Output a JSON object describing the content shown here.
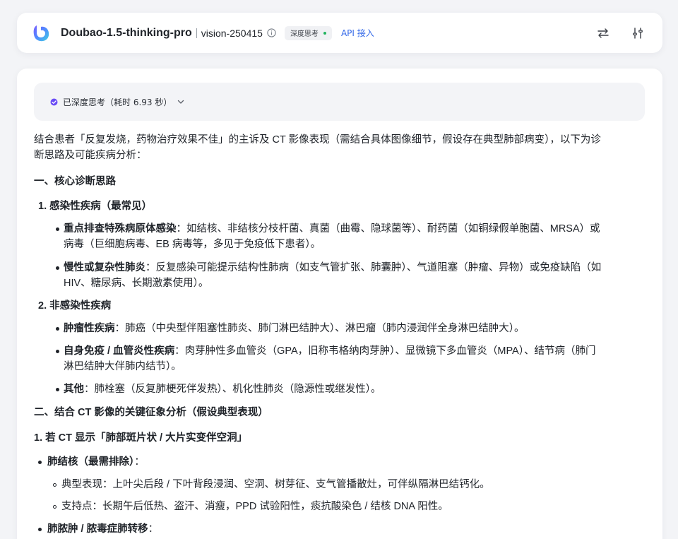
{
  "header": {
    "model_name": "Doubao-1.5-thinking-pro",
    "model_version": "vision-250415",
    "badge_label": "深度思考",
    "api_link": "API 接入"
  },
  "thinking": {
    "label": "已深度思考（耗时 6.93 秒）"
  },
  "content": {
    "intro_line1": "结合患者「反复发烧，药物治疗效果不佳」的主诉及 CT 影像表现（需结合具体图像细节，假设存在典型肺部病变），以下为诊",
    "intro_line2": "断思路及可能疾病分析：",
    "section1_title": "一、核心诊断思路",
    "s1_item1_title": "1. 感染性疾病（最常见）",
    "s1_i1_b1_bold": "重点排查特殊病原体感染",
    "s1_i1_b1_line1": "：如结核、非结核分枝杆菌、真菌（曲霉、隐球菌等）、耐药菌（如铜绿假单胞菌、MRSA）或",
    "s1_i1_b1_line2": "病毒（巨细胞病毒、EB 病毒等，多见于免疫低下患者）。",
    "s1_i1_b2_bold": "慢性或复杂性肺炎",
    "s1_i1_b2_line1": "：反复感染可能提示结构性肺病（如支气管扩张、肺囊肿）、气道阻塞（肿瘤、异物）或免疫缺陷（如",
    "s1_i1_b2_line2": "HIV、糖尿病、长期激素使用）。",
    "s1_item2_title": "2. 非感染性疾病",
    "s1_i2_b1_bold": "肿瘤性疾病",
    "s1_i2_b1_line1": "：肺癌（中央型伴阻塞性肺炎、肺门淋巴结肿大）、淋巴瘤（肺内浸润伴全身淋巴结肿大）。",
    "s1_i2_b2_bold": "自身免疫 / 血管炎性疾病",
    "s1_i2_b2_line1": "：肉芽肿性多血管炎（GPA，旧称韦格纳肉芽肿）、显微镜下多血管炎（MPA）、结节病（肺门",
    "s1_i2_b2_line2": "淋巴结肿大伴肺内结节）。",
    "s1_i2_b3_bold": "其他",
    "s1_i2_b3_line1": "：肺栓塞（反复肺梗死伴发热）、机化性肺炎（隐源性或继发性）。",
    "section2_title": "二、结合 CT 影像的关键征象分析（假设典型表现）",
    "s2_sub1_title": "1. 若 CT 显示「肺部斑片状 / 大片实变伴空洞」",
    "s2_tb_title": "肺结核（最需排除）",
    "s2_tb_title_suffix": "：",
    "s2_tb_d1": "典型表现：上叶尖后段 / 下叶背段浸润、空洞、树芽征、支气管播散灶，可伴纵隔淋巴结钙化。",
    "s2_tb_d2": "支持点：长期午后低热、盗汗、消瘦，PPD 试验阳性，痰抗酸染色 / 结核 DNA 阳性。",
    "s2_abs_title": "肺脓肿 / 脓毒症肺转移",
    "s2_abs_title_suffix": "："
  }
}
